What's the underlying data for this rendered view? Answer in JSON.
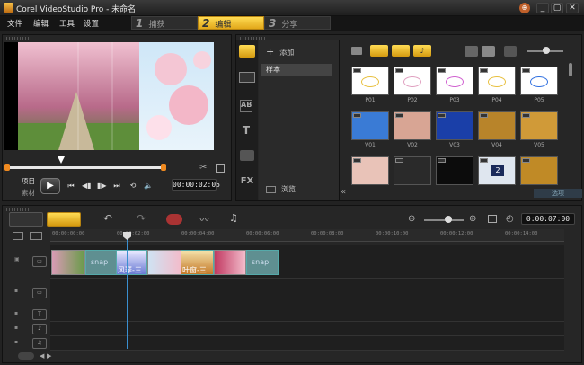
{
  "window": {
    "title": "Corel VideoStudio Pro - 未命名",
    "close": "✕",
    "maximize": "▢",
    "minimize": "_"
  },
  "menu": [
    "文件",
    "编辑",
    "工具",
    "设置"
  ],
  "steps": [
    {
      "num": "1",
      "label": "捕获",
      "active": false
    },
    {
      "num": "2",
      "label": "编辑",
      "active": true
    },
    {
      "num": "3",
      "label": "分享",
      "active": false
    }
  ],
  "player": {
    "mode_project": "项目",
    "mode_clip": "素材",
    "timecode": "00:00:02:05"
  },
  "library": {
    "add_label": "添加",
    "folder_item": "样本",
    "browse_label": "浏览",
    "options_label": "选项",
    "categories": [
      "AB",
      "T",
      "FX"
    ],
    "thumbnails": [
      {
        "label": "P01",
        "bg": "#ffffff",
        "kind": "photo"
      },
      {
        "label": "P02",
        "bg": "#ffffff",
        "kind": "photo"
      },
      {
        "label": "P03",
        "bg": "#ffffff",
        "kind": "photo"
      },
      {
        "label": "P04",
        "bg": "#ffffff",
        "kind": "photo"
      },
      {
        "label": "P05",
        "bg": "#ffffff",
        "kind": "photo"
      },
      {
        "label": "V01",
        "bg": "#3a7bd5",
        "kind": "video"
      },
      {
        "label": "V02",
        "bg": "#d8a594",
        "kind": "video"
      },
      {
        "label": "V03",
        "bg": "#1a3fa8",
        "kind": "video"
      },
      {
        "label": "V04",
        "bg": "#b8842a",
        "kind": "video"
      },
      {
        "label": "V05",
        "bg": "#d09a38",
        "kind": "video"
      },
      {
        "label": "",
        "bg": "#e9c3b8",
        "kind": "video"
      },
      {
        "label": "",
        "bg": "#2a2a2a",
        "kind": "video"
      },
      {
        "label": "",
        "bg": "#0c0c0c",
        "kind": "video"
      },
      {
        "label": "2",
        "bg": "#dfe6ef",
        "kind": "video"
      },
      {
        "label": "",
        "bg": "#c08a26",
        "kind": "video"
      }
    ]
  },
  "timeline": {
    "timecode": "0:00:07:00",
    "ruler": [
      "00:00:00:00",
      "00:00:02:00",
      "00:00:04:00",
      "00:00:06:00",
      "00:00:08:00",
      "00:00:10:00",
      "00:00:12:00",
      "00:00:14:00"
    ],
    "clips": [
      {
        "label": "",
        "kind": "image"
      },
      {
        "label": "snap",
        "kind": "transition"
      },
      {
        "label": "风琴-三",
        "kind": "transition"
      },
      {
        "label": "",
        "kind": "image"
      },
      {
        "label": "叶窗-三",
        "kind": "transition"
      },
      {
        "label": "",
        "kind": "image"
      },
      {
        "label": "snap",
        "kind": "transition"
      }
    ],
    "playhead_time": "00:00:02:05"
  },
  "colors": {
    "accent": "#f0c020",
    "active_step": "#f4c52a",
    "timeline_blue": "#3a8fd0"
  }
}
